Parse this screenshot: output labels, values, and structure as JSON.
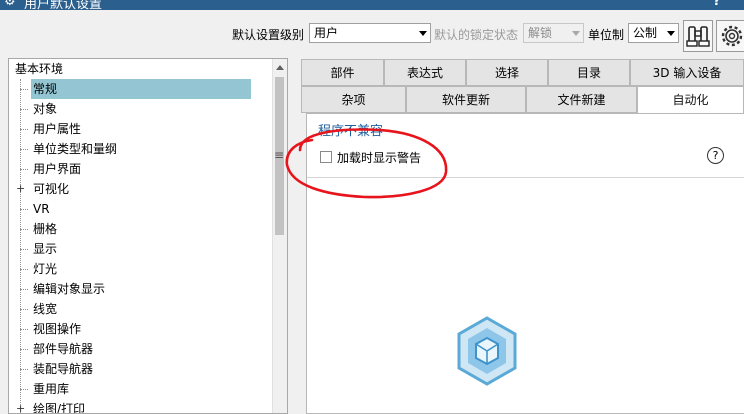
{
  "window": {
    "title": "用户默认设置",
    "icon": "gear-icon",
    "help_glyph": "?"
  },
  "toolbar": {
    "level_label": "默认设置级别",
    "level_value": "用户",
    "lock_label": "默认的锁定状态",
    "lock_value": "解锁",
    "unit_label": "单位制",
    "unit_value": "公制",
    "icons": [
      "binoculars-icon",
      "gear-icon"
    ]
  },
  "tree": {
    "root": "基本环境",
    "items": [
      {
        "label": "常规",
        "selected": true,
        "expandable": false
      },
      {
        "label": "对象",
        "selected": false,
        "expandable": false
      },
      {
        "label": "用户属性",
        "selected": false,
        "expandable": false
      },
      {
        "label": "单位类型和量纲",
        "selected": false,
        "expandable": false
      },
      {
        "label": "用户界面",
        "selected": false,
        "expandable": false
      },
      {
        "label": "可视化",
        "selected": false,
        "expandable": true
      },
      {
        "label": "VR",
        "selected": false,
        "expandable": false
      },
      {
        "label": "栅格",
        "selected": false,
        "expandable": false
      },
      {
        "label": "显示",
        "selected": false,
        "expandable": false
      },
      {
        "label": "灯光",
        "selected": false,
        "expandable": false
      },
      {
        "label": "编辑对象显示",
        "selected": false,
        "expandable": false
      },
      {
        "label": "线宽",
        "selected": false,
        "expandable": false
      },
      {
        "label": "视图操作",
        "selected": false,
        "expandable": false
      },
      {
        "label": "部件导航器",
        "selected": false,
        "expandable": false
      },
      {
        "label": "装配导航器",
        "selected": false,
        "expandable": false
      },
      {
        "label": "重用库",
        "selected": false,
        "expandable": false
      },
      {
        "label": "绘图/打印",
        "selected": false,
        "expandable": true
      }
    ]
  },
  "tabs": {
    "row1": [
      "部件",
      "表达式",
      "选择",
      "目录",
      "3D 输入设备"
    ],
    "row2": [
      "杂项",
      "软件更新",
      "文件新建",
      "自动化"
    ],
    "active": "自动化"
  },
  "content": {
    "section_title": "程序不兼容",
    "checkbox_label": "加载时显示警告",
    "checkbox_checked": false,
    "help_glyph": "?"
  },
  "colors": {
    "title_bar": "#2b5f8e",
    "selection": "#93c6d2",
    "section_title": "#1f5e9c",
    "annotation": "#e8141c",
    "logo": "#5aa9d6"
  }
}
